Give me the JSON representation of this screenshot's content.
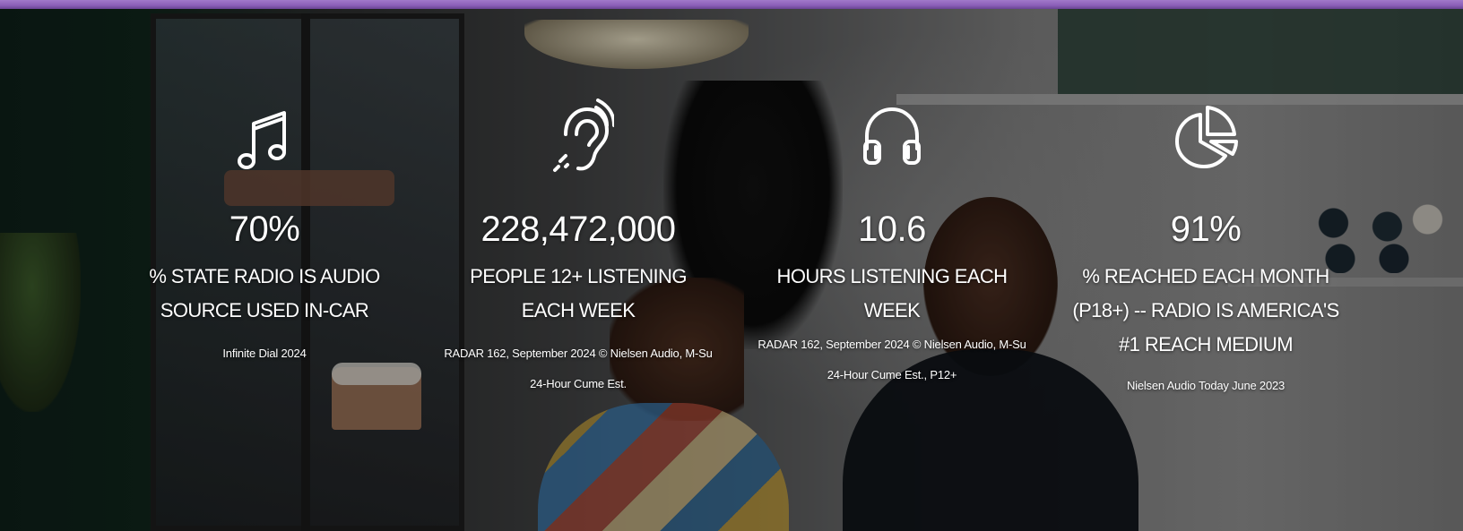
{
  "theme": {
    "accent": "#8b5fb8",
    "text": "#ffffff"
  },
  "stats": [
    {
      "icon": "music-note-icon",
      "value": "70%",
      "label": "% STATE RADIO IS AUDIO SOURCE USED IN-CAR",
      "source": "Infinite Dial 2024"
    },
    {
      "icon": "ear-icon",
      "value": "228,472,000",
      "label": "PEOPLE 12+ LISTENING EACH WEEK",
      "source": "RADAR 162, September 2024 © Nielsen Audio, M-Su 24-Hour Cume Est."
    },
    {
      "icon": "headphones-icon",
      "value": "10.6",
      "label": "HOURS LISTENING EACH WEEK",
      "source": "RADAR 162, September 2024 © Nielsen Audio, M-Su 24-Hour Cume Est., P12+"
    },
    {
      "icon": "pie-chart-icon",
      "value": "91%",
      "label": "% REACHED EACH MONTH (P18+) -- RADIO IS AMERICA'S #1 REACH MEDIUM",
      "source": "Nielsen Audio Today June 2023"
    }
  ]
}
